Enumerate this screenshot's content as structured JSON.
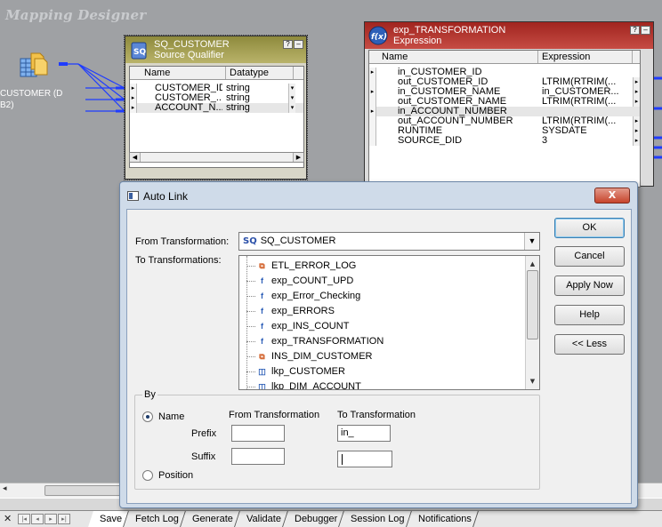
{
  "canvas": {
    "title": "Mapping Designer",
    "source_label_line1": "CUSTOMER (D",
    "source_label_line2": "B2)"
  },
  "sq_transform": {
    "title": "SQ_CUSTOMER",
    "subtitle": "Source Qualifier",
    "col_name": "Name",
    "col_datatype": "Datatype",
    "rows": [
      {
        "name": "CUSTOMER_ID",
        "type": "string"
      },
      {
        "name": "CUSTOMER_...",
        "type": "string"
      },
      {
        "name": "ACCOUNT_N...",
        "type": "string"
      }
    ]
  },
  "exp_transform": {
    "title": "exp_TRANSFORMATION",
    "subtitle": "Expression",
    "col_name": "Name",
    "col_expression": "Expression",
    "rows": [
      {
        "name": "in_CUSTOMER_ID",
        "expr": ""
      },
      {
        "name": "out_CUSTOMER_ID",
        "expr": "LTRIM(RTRIM(..."
      },
      {
        "name": "in_CUSTOMER_NAME",
        "expr": "in_CUSTOMER..."
      },
      {
        "name": "out_CUSTOMER_NAME",
        "expr": "LTRIM(RTRIM(..."
      },
      {
        "name": "in_ACCOUNT_NUMBER",
        "expr": ""
      },
      {
        "name": "out_ACCOUNT_NUMBER",
        "expr": "LTRIM(RTRIM(..."
      },
      {
        "name": "RUNTIME",
        "expr": "SYSDATE"
      },
      {
        "name": "SOURCE_DID",
        "expr": "3"
      }
    ]
  },
  "dialog": {
    "title": "Auto Link",
    "close_label": "X",
    "from_label": "From Transformation:",
    "from_value": "SQ_CUSTOMER",
    "from_badge": "SQ",
    "to_label": "To Transformations:",
    "to_items": [
      {
        "label": "ETL_ERROR_LOG",
        "icon": "target-icon"
      },
      {
        "label": "exp_COUNT_UPD",
        "icon": "expression-icon"
      },
      {
        "label": "exp_Error_Checking",
        "icon": "expression-icon"
      },
      {
        "label": "exp_ERRORS",
        "icon": "expression-icon"
      },
      {
        "label": "exp_INS_COUNT",
        "icon": "expression-icon"
      },
      {
        "label": "exp_TRANSFORMATION",
        "icon": "expression-icon"
      },
      {
        "label": "INS_DIM_CUSTOMER",
        "icon": "target-icon"
      },
      {
        "label": "lkp_CUSTOMER",
        "icon": "lookup-icon"
      },
      {
        "label": "lkp_DIM_ACCOUNT",
        "icon": "lookup-icon"
      }
    ],
    "selected_index": 5,
    "buttons": {
      "ok": "OK",
      "cancel": "Cancel",
      "apply": "Apply Now",
      "help": "Help",
      "less": "<< Less"
    },
    "by": {
      "title": "By",
      "name_label": "Name",
      "position_label": "Position",
      "col_from": "From Transformation",
      "col_to": "To Transformation",
      "prefix_label": "Prefix",
      "suffix_label": "Suffix",
      "prefix_from": "",
      "prefix_to": "in_",
      "suffix_from": "",
      "suffix_to": ""
    }
  },
  "tabs": [
    "Save",
    "Fetch Log",
    "Generate",
    "Validate",
    "Debugger",
    "Session Log",
    "Notifications"
  ],
  "active_tab": "Save"
}
